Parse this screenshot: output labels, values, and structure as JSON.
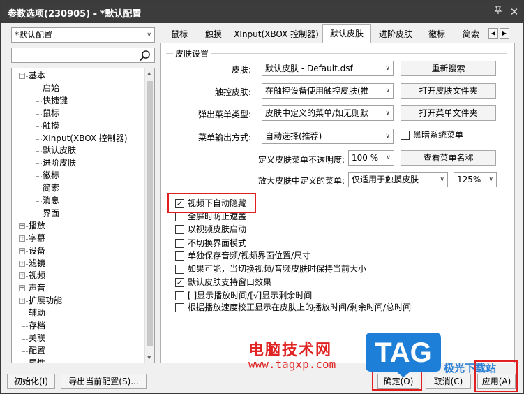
{
  "window": {
    "title": "参数选项(230905) - *默认配置",
    "pin_icon": "pin-icon",
    "close_icon": "close-icon"
  },
  "profile_select": {
    "value": "*默认配置"
  },
  "search": {
    "value": ""
  },
  "tree": {
    "items": [
      {
        "label": "基本",
        "expander": "−"
      },
      {
        "label": "启始"
      },
      {
        "label": "快捷键"
      },
      {
        "label": "鼠标"
      },
      {
        "label": "触摸"
      },
      {
        "label": "XInput(XBOX 控制器)"
      },
      {
        "label": "默认皮肤"
      },
      {
        "label": "进阶皮肤"
      },
      {
        "label": "徽标"
      },
      {
        "label": "简索"
      },
      {
        "label": "消息"
      },
      {
        "label": "界面"
      },
      {
        "label": "播放",
        "expander": "+"
      },
      {
        "label": "字幕",
        "expander": "+"
      },
      {
        "label": "设备",
        "expander": "+"
      },
      {
        "label": "滤镜",
        "expander": "+"
      },
      {
        "label": "视频",
        "expander": "+"
      },
      {
        "label": "声音",
        "expander": "+"
      },
      {
        "label": "扩展功能",
        "expander": "+"
      },
      {
        "label": "辅助"
      },
      {
        "label": "存档"
      },
      {
        "label": "关联"
      },
      {
        "label": "配置"
      },
      {
        "label": "属性"
      }
    ]
  },
  "tabs": [
    {
      "label": "鼠标"
    },
    {
      "label": "触摸"
    },
    {
      "label": "XInput(XBOX 控制器)"
    },
    {
      "label": "默认皮肤",
      "active": true
    },
    {
      "label": "进阶皮肤"
    },
    {
      "label": "徽标"
    },
    {
      "label": "简索"
    }
  ],
  "skin_settings": {
    "group_title": "皮肤设置",
    "skin_label": "皮肤:",
    "skin_value": "默认皮肤 - Default.dsf",
    "rescan_button": "重新搜索",
    "touch_skin_label": "触控皮肤:",
    "touch_skin_value": "在触控设备使用触控皮肤(推",
    "open_skin_folder_button": "打开皮肤文件夹",
    "popup_menu_label": "弹出菜单类型:",
    "popup_menu_value": "皮肤中定义的菜单/如无则默",
    "open_menu_folder_button": "打开菜单文件夹",
    "menu_output_label": "菜单输出方式:",
    "menu_output_value": "自动选择(推荐)",
    "dark_system_menu_label": "黑暗系统菜单",
    "dark_system_menu_checked": false,
    "opacity_label": "定义皮肤菜单不透明度:",
    "opacity_value": "100 %",
    "view_menu_names_button": "查看菜单名称",
    "zoom_menu_label": "放大皮肤中定义的菜单:",
    "zoom_menu_value": "仅适用于触摸皮肤",
    "zoom_percent_value": "125%"
  },
  "options": [
    {
      "label": "视频下自动隐藏",
      "checked": true
    },
    {
      "label": "全屏时防止遮盖",
      "checked": false
    },
    {
      "label": "以视频皮肤启动",
      "checked": false
    },
    {
      "label": "不切换界面模式",
      "checked": false
    },
    {
      "label": "单独保存音频/视频界面位置/尺寸",
      "checked": false
    },
    {
      "label": "如果可能，当切换视频/音频皮肤时保持当前大小",
      "checked": false
    },
    {
      "label": "默认皮肤支持窗口效果",
      "checked": true
    },
    {
      "label": "[ ]显示播放时间/[√]显示剩余时间",
      "checked": false
    },
    {
      "label": "根据播放速度校正显示在皮肤上的播放时间/剩余时间/总时间",
      "checked": false
    }
  ],
  "footer": {
    "init_button": "初始化(I)",
    "export_button": "导出当前配置(S)...",
    "ok_button": "确定(O)",
    "cancel_button": "取消(C)",
    "apply_button": "应用(A)"
  },
  "watermark": {
    "site_name": "电脑技术网",
    "site_url": "www.tagxp.com",
    "logo_text": "TAG",
    "partner_text": "极光下载站"
  },
  "colors": {
    "titlebar": "#3c3c3c",
    "highlight_border": "#e02020",
    "watermark_red": "#e02323",
    "tag_blue": "#1e7fd8"
  }
}
